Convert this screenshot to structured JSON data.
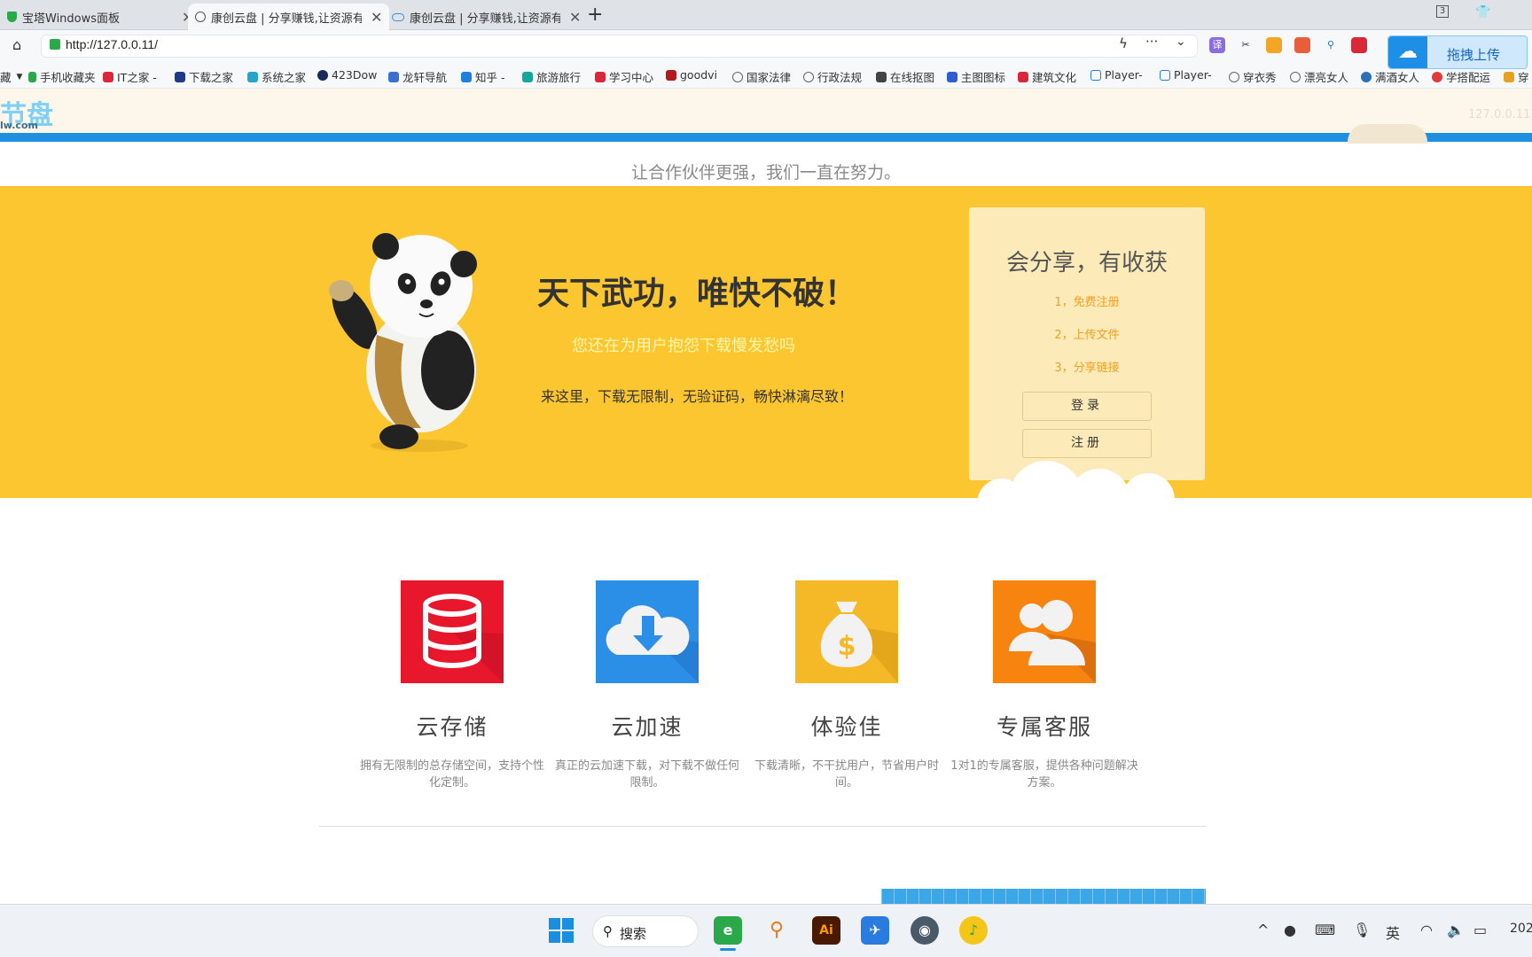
{
  "browser": {
    "tabs": [
      {
        "title": "宝塔Windows面板",
        "close": "✕"
      },
      {
        "title": "康创云盘 | 分享赚钱,让资源有",
        "close": "✕"
      },
      {
        "title": "康创云盘 | 分享赚钱,让资源有",
        "close": "✕"
      }
    ],
    "new_tab": "+",
    "url": "http://127.0.0.11/",
    "tab_count": "3",
    "bookmarks": [
      "藏",
      "手机收藏夹",
      "IT之家 -",
      "下载之家",
      "系统之家",
      "423Dow",
      "龙轩导航",
      "知乎 -",
      "旅游旅行",
      "学习中心",
      "goodvi",
      "国家法律",
      "行政法规",
      "在线抠图",
      "主图图标",
      "建筑文化",
      "Player-",
      "Player-",
      "穿衣秀",
      "漂亮女人",
      "满酒女人",
      "学搭配运",
      "穿"
    ]
  },
  "upload": {
    "label": "拖拽上传"
  },
  "site": {
    "logo": "节盘",
    "logo_sub": "lw.com",
    "header_right": "127.0.0.11",
    "tagline": "让合作伙伴更强，我们一直在努力。",
    "banner": {
      "headline": "天下武功，唯快不破！",
      "sub1": "您还在为用户抱怨下载慢发愁吗",
      "sub2": "来这里，下载无限制，无验证码，畅快淋漓尽致！"
    },
    "panel": {
      "title": "会分享，有收获",
      "steps": [
        "1，免费注册",
        "2，上传文件",
        "3，分享链接"
      ],
      "login": "登录",
      "register": "注册"
    },
    "features": [
      {
        "title": "云存储",
        "desc": "拥有无限制的总存储空间，支持个性化定制。",
        "color": "#e8172c",
        "icon": "database-icon"
      },
      {
        "title": "云加速",
        "desc": "真正的云加速下载，对下载不做任何限制。",
        "color": "#2b8fe8",
        "icon": "cloud-download-icon"
      },
      {
        "title": "体验佳",
        "desc": "下载清晰，不干扰用户，节省用户时间。",
        "color": "#f5b928",
        "icon": "money-bag-icon"
      },
      {
        "title": "专属客服",
        "desc": "1对1的专属客服，提供各种问题解决方案。",
        "color": "#f7840f",
        "icon": "users-icon"
      }
    ]
  },
  "taskbar": {
    "search": "搜索",
    "ime": "英",
    "clock": "202"
  }
}
